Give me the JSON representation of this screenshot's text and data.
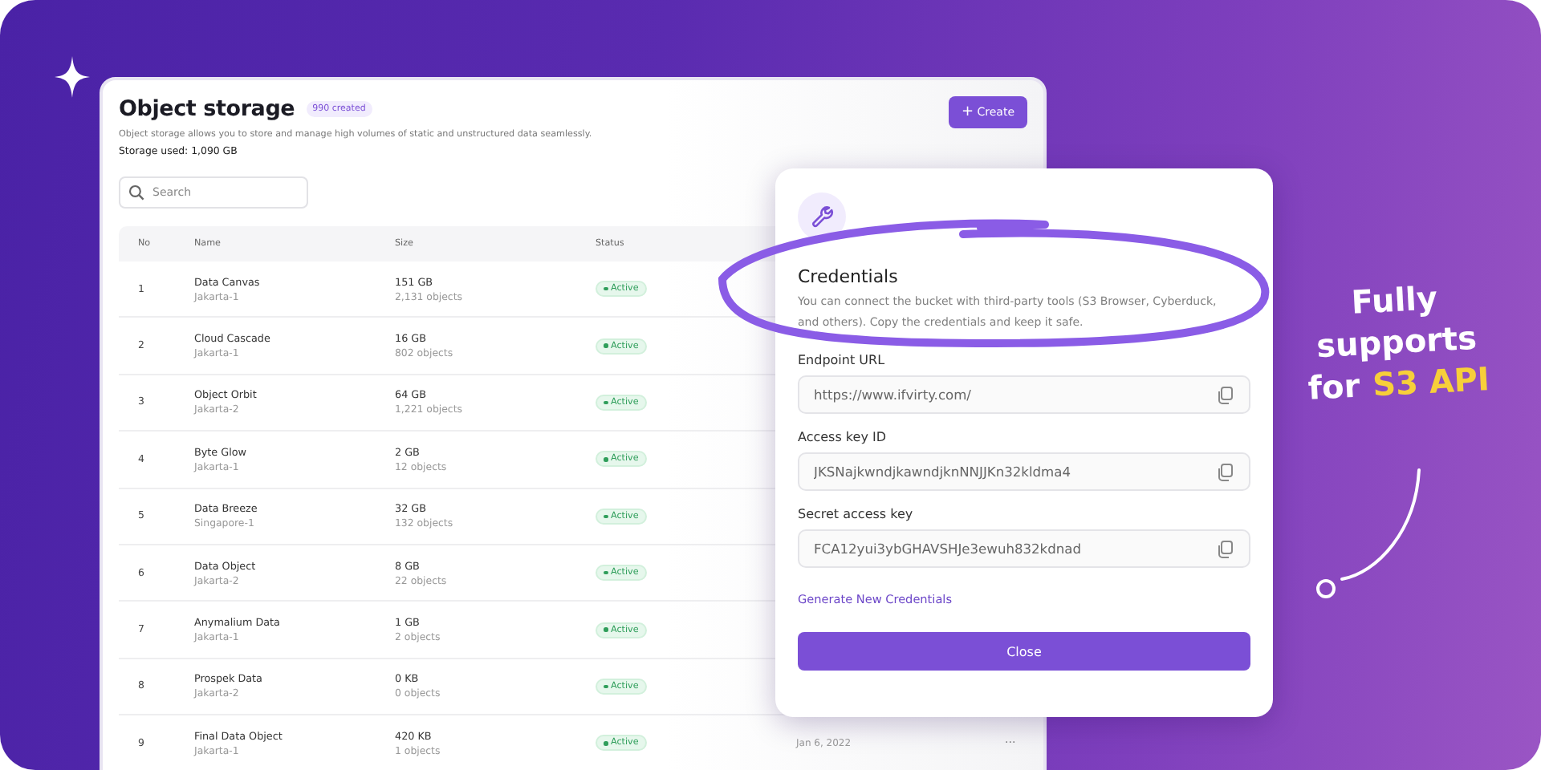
{
  "storage": {
    "title": "Object storage",
    "badge": "990 created",
    "description": "Object storage allows you to store and manage high volumes of static and unstructured data seamlessly.",
    "usage": "Storage used: 1,090 GB",
    "create_button": "Create",
    "create_icon": "+",
    "search": {
      "placeholder": "Search"
    }
  },
  "table": {
    "columns": [
      "No",
      "Name",
      "Size",
      "Status"
    ],
    "rows": [
      {
        "no": "1",
        "name": "Data Canvas",
        "region": "Jakarta-1",
        "size": "151 GB",
        "objects": "2,131 objects",
        "status": {
          "label": "Active",
          "kind": "active"
        }
      },
      {
        "no": "2",
        "name": "Cloud Cascade",
        "region": "Jakarta-1",
        "size": "16 GB",
        "objects": "802 objects",
        "status": {
          "label": "Active",
          "kind": "active"
        }
      },
      {
        "no": "3",
        "name": "Object Orbit",
        "region": "Jakarta-2",
        "size": "64 GB",
        "objects": "1,221 objects",
        "status": {
          "label": "Active",
          "kind": "active"
        }
      },
      {
        "no": "4",
        "name": "Byte Glow",
        "region": "Jakarta-1",
        "size": "2 GB",
        "objects": "12 objects",
        "status": {
          "label": "Active",
          "kind": "active"
        }
      },
      {
        "no": "5",
        "name": "Data Breeze",
        "region": "Singapore-1",
        "size": "32 GB",
        "objects": "132 objects",
        "status": {
          "label": "Active",
          "kind": "active"
        }
      },
      {
        "no": "6",
        "name": "Data Object",
        "region": "Jakarta-2",
        "size": "8 GB",
        "objects": "22 objects",
        "status": {
          "label": "Active",
          "kind": "active"
        }
      },
      {
        "no": "7",
        "name": "Anymalium Data",
        "region": "Jakarta-1",
        "size": "1 GB",
        "objects": "2 objects",
        "status": {
          "label": "Active",
          "kind": "active"
        }
      },
      {
        "no": "8",
        "name": "Prospek Data",
        "region": "Jakarta-2",
        "size": "0 KB",
        "objects": "0 objects",
        "status": {
          "label": "Active",
          "kind": "active"
        }
      },
      {
        "no": "9",
        "name": "Final Data Object",
        "region": "Jakarta-1",
        "size": "420 KB",
        "objects": "1 objects",
        "status": {
          "label": "Active",
          "kind": "active"
        },
        "date": "Jan 6, 2022",
        "menu": "···"
      }
    ]
  },
  "dialog": {
    "title": "Credentials",
    "description": "You can connect the bucket with third-party tools (S3 Browser, Cyberduck, and others). Copy the credentials and keep it safe.",
    "fields": [
      {
        "label": "Endpoint URL",
        "value": "https://www.ifvirty.com/"
      },
      {
        "label": "Access key ID",
        "value": "JKSNajkwndjkawndjknNNJJKn32kldma4"
      },
      {
        "label": "Secret access key",
        "value": "FCA12yui3ybGHAVSHJe3ewuh832kdnad"
      }
    ],
    "link": "Generate New Credentials",
    "close_button": "Close"
  },
  "callout": {
    "lines": [
      "Fully",
      "supports",
      "for"
    ],
    "highlight": "S3 API"
  }
}
